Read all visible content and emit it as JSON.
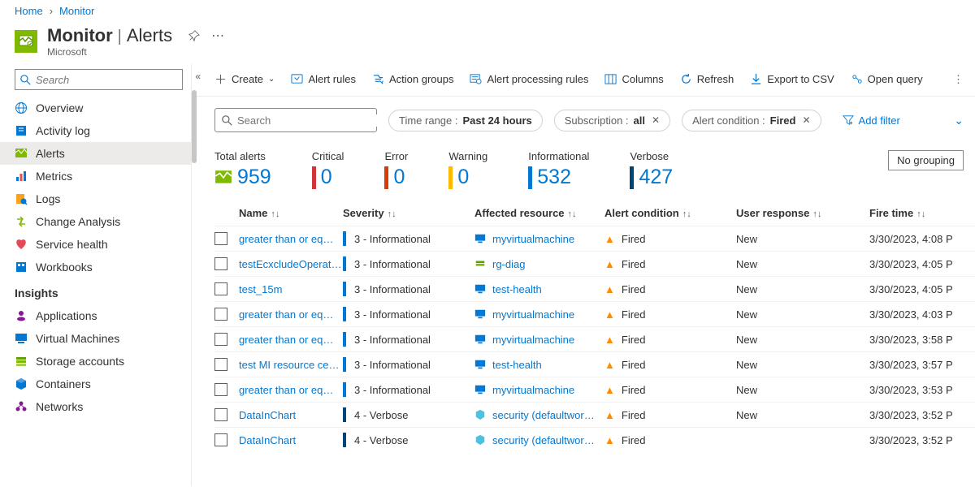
{
  "breadcrumb": {
    "home": "Home",
    "monitor": "Monitor"
  },
  "header": {
    "title": "Monitor",
    "section": "Alerts",
    "subtitle": "Microsoft"
  },
  "sidebar": {
    "search_placeholder": "Search",
    "items": [
      {
        "label": "Overview",
        "icon": "globe"
      },
      {
        "label": "Activity log",
        "icon": "book"
      },
      {
        "label": "Alerts",
        "icon": "alert",
        "active": true
      },
      {
        "label": "Metrics",
        "icon": "metrics"
      },
      {
        "label": "Logs",
        "icon": "logs"
      },
      {
        "label": "Change Analysis",
        "icon": "change"
      },
      {
        "label": "Service health",
        "icon": "health"
      },
      {
        "label": "Workbooks",
        "icon": "workbooks"
      }
    ],
    "insights_label": "Insights",
    "insights": [
      {
        "label": "Applications",
        "icon": "app"
      },
      {
        "label": "Virtual Machines",
        "icon": "vm"
      },
      {
        "label": "Storage accounts",
        "icon": "storage"
      },
      {
        "label": "Containers",
        "icon": "containers"
      },
      {
        "label": "Networks",
        "icon": "networks"
      }
    ]
  },
  "toolbar": {
    "create": "Create",
    "alert_rules": "Alert rules",
    "action_groups": "Action groups",
    "processing": "Alert processing rules",
    "columns": "Columns",
    "refresh": "Refresh",
    "export": "Export to CSV",
    "open_query": "Open query"
  },
  "filters": {
    "search_placeholder": "Search",
    "time_label": "Time range :",
    "time_val": "Past 24 hours",
    "sub_label": "Subscription :",
    "sub_val": "all",
    "cond_label": "Alert condition :",
    "cond_val": "Fired",
    "add": "Add filter"
  },
  "stats": {
    "total": {
      "label": "Total alerts",
      "value": "959"
    },
    "critical": {
      "label": "Critical",
      "value": "0"
    },
    "error": {
      "label": "Error",
      "value": "0"
    },
    "warning": {
      "label": "Warning",
      "value": "0"
    },
    "info": {
      "label": "Informational",
      "value": "532"
    },
    "verbose": {
      "label": "Verbose",
      "value": "427"
    },
    "grouping": "No grouping"
  },
  "columns": {
    "name": "Name",
    "severity": "Severity",
    "resource": "Affected resource",
    "condition": "Alert condition",
    "response": "User response",
    "time": "Fire time"
  },
  "rows": [
    {
      "name": "greater than or eq…",
      "severity": "3 - Informational",
      "sev": "info",
      "resource": "myvirtualmachine",
      "resType": "vm",
      "condition": "Fired",
      "response": "New",
      "time": "3/30/2023, 4:08 P"
    },
    {
      "name": "testEcxcludeOperat…",
      "severity": "3 - Informational",
      "sev": "info",
      "resource": "rg-diag",
      "resType": "rg",
      "condition": "Fired",
      "response": "New",
      "time": "3/30/2023, 4:05 P"
    },
    {
      "name": "test_15m",
      "severity": "3 - Informational",
      "sev": "info",
      "resource": "test-health",
      "resType": "vm",
      "condition": "Fired",
      "response": "New",
      "time": "3/30/2023, 4:05 P"
    },
    {
      "name": "greater than or eq…",
      "severity": "3 - Informational",
      "sev": "info",
      "resource": "myvirtualmachine",
      "resType": "vm",
      "condition": "Fired",
      "response": "New",
      "time": "3/30/2023, 4:03 P"
    },
    {
      "name": "greater than or eq…",
      "severity": "3 - Informational",
      "sev": "info",
      "resource": "myvirtualmachine",
      "resType": "vm",
      "condition": "Fired",
      "response": "New",
      "time": "3/30/2023, 3:58 P"
    },
    {
      "name": "test MI resource ce…",
      "severity": "3 - Informational",
      "sev": "info",
      "resource": "test-health",
      "resType": "vm",
      "condition": "Fired",
      "response": "New",
      "time": "3/30/2023, 3:57 P"
    },
    {
      "name": "greater than or eq…",
      "severity": "3 - Informational",
      "sev": "info",
      "resource": "myvirtualmachine",
      "resType": "vm",
      "condition": "Fired",
      "response": "New",
      "time": "3/30/2023, 3:53 P"
    },
    {
      "name": "DataInChart",
      "severity": "4 - Verbose",
      "sev": "verbose",
      "resource": "security (defaultwor…",
      "resType": "sec",
      "condition": "Fired",
      "response": "New",
      "time": "3/30/2023, 3:52 P"
    },
    {
      "name": "DataInChart",
      "severity": "4 - Verbose",
      "sev": "verbose",
      "resource": "security (defaultwor…",
      "resType": "sec",
      "condition": "Fired",
      "response": "",
      "time": "3/30/2023, 3:52 P"
    }
  ]
}
